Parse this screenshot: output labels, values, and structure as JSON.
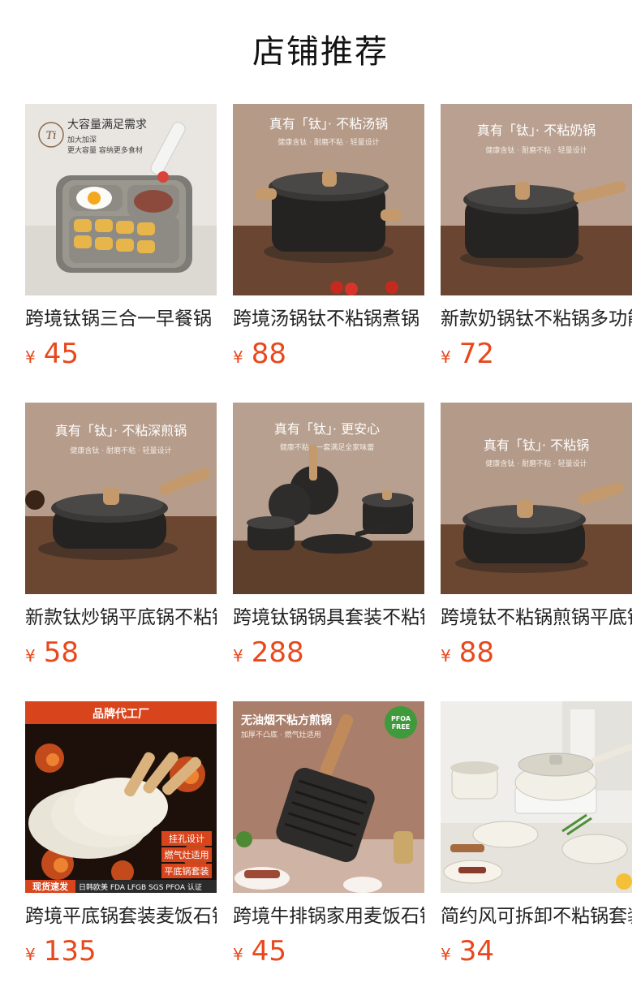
{
  "page": {
    "title": "店铺推荐"
  },
  "currency": "¥",
  "colors": {
    "price": "#e8481c",
    "name": "#222222"
  },
  "products": [
    {
      "name": "跨境钛锅三合一早餐锅",
      "price": "45",
      "overlay": {
        "headline": "大容量满足需求",
        "sub1": "加大加深",
        "sub2": "更大容量 容纳更多食材",
        "logo": "Ti"
      }
    },
    {
      "name": "跨境汤锅钛不粘锅煮锅",
      "price": "88",
      "overlay": {
        "headline": "真有「钛」· 不粘汤锅",
        "sub": "健康含钛 · 耐磨不粘 · 轻量设计"
      }
    },
    {
      "name": "新款奶锅钛不粘锅多功能",
      "price": "72",
      "overlay": {
        "headline": "真有「钛」· 不粘奶锅",
        "sub": "健康含钛 · 耐磨不粘 · 轻量设计"
      }
    },
    {
      "name": "新款钛炒锅平底锅不粘锅",
      "price": "58",
      "overlay": {
        "headline": "真有「钛」· 不粘深煎锅",
        "sub": "健康含钛 · 耐磨不粘 · 轻量设计"
      }
    },
    {
      "name": "跨境钛锅锅具套装不粘锅",
      "price": "288",
      "overlay": {
        "headline": "真有「钛」· 更安心",
        "sub": "健康不粘 · 一套满足全家味蕾"
      }
    },
    {
      "name": "跨境钛不粘锅煎锅平底锅",
      "price": "88",
      "overlay": {
        "headline": "真有「钛」· 不粘锅",
        "sub": "健康含钛 · 耐磨不粘 · 轻量设计"
      }
    },
    {
      "name": "跨境平底锅套装麦饭石锅",
      "price": "135",
      "overlay": {
        "banner": "品牌代工厂",
        "tag1": "挂孔设计",
        "tag2": "燃气灶适用",
        "tag3": "平底锅套装",
        "footer_badge": "现货速发",
        "footer_text": "日韩欧美 FDA LFGB SGS PFOA 认证"
      }
    },
    {
      "name": "跨境牛排锅家用麦饭石锅",
      "price": "45",
      "overlay": {
        "headline": "无油烟不粘方煎锅",
        "sub": "加厚不凸底 · 燃气灶适用",
        "badge1": "PFOA",
        "badge2": "FREE"
      }
    },
    {
      "name": "简约风可拆卸不粘锅套装",
      "price": "34",
      "overlay": {}
    }
  ]
}
